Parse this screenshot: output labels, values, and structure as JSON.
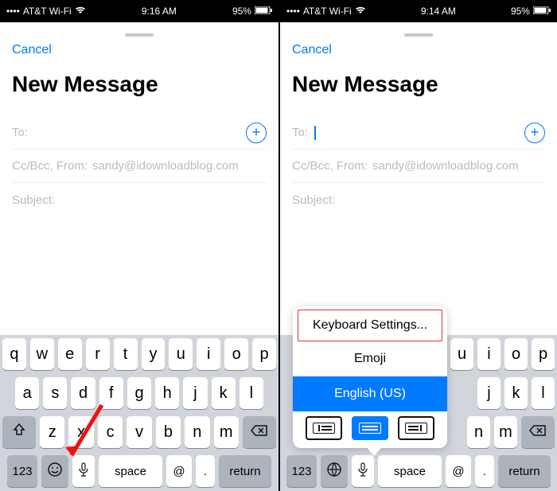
{
  "left": {
    "status": {
      "carrier": "AT&T Wi-Fi",
      "time": "9:16 AM",
      "battery": "95%"
    },
    "cancel": "Cancel",
    "title": "New Message",
    "to_label": "To:",
    "ccbcc_label": "Cc/Bcc, From:",
    "from_email": "sandy@idownloadblog.com",
    "subject_label": "Subject:",
    "keyboard": {
      "row1": [
        "q",
        "w",
        "e",
        "r",
        "t",
        "y",
        "u",
        "i",
        "o",
        "p"
      ],
      "row2": [
        "a",
        "s",
        "d",
        "f",
        "g",
        "h",
        "j",
        "k",
        "l"
      ],
      "row3": [
        "z",
        "x",
        "c",
        "v",
        "b",
        "n",
        "m"
      ],
      "numbers": "123",
      "space": "space",
      "at": "@",
      "dot": ".",
      "return": "return"
    }
  },
  "right": {
    "status": {
      "carrier": "AT&T Wi-Fi",
      "time": "9:14 AM",
      "battery": "95%"
    },
    "cancel": "Cancel",
    "title": "New Message",
    "to_label": "To:",
    "ccbcc_label": "Cc/Bcc, From:",
    "from_email": "sandy@idownloadblog.com",
    "subject_label": "Subject:",
    "popup": {
      "settings": "Keyboard Settings...",
      "emoji": "Emoji",
      "english": "English (US)"
    },
    "keyboard": {
      "row1": [
        "u",
        "i",
        "o",
        "p"
      ],
      "row2": [
        "j",
        "k",
        "l"
      ],
      "row3": [
        "n",
        "m"
      ],
      "numbers": "123",
      "space": "space",
      "at": "@",
      "dot": ".",
      "return": "return"
    }
  }
}
